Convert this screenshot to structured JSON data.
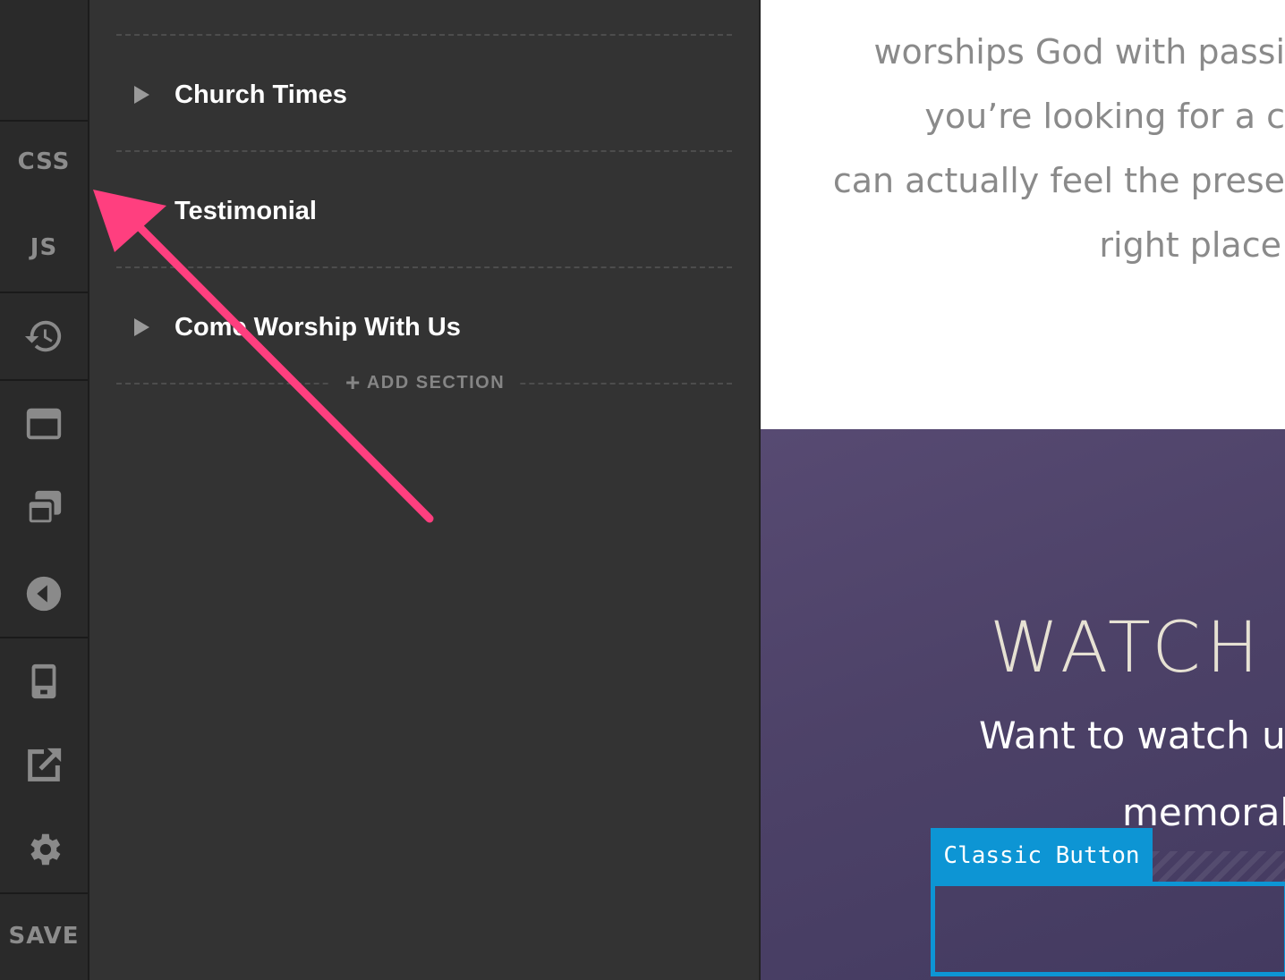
{
  "rail": {
    "css_label": "CSS",
    "js_label": "JS",
    "save_label": "SAVE",
    "icons": [
      "history-icon",
      "layout-icon",
      "layers-icon",
      "back-icon",
      "mobile-preview-icon",
      "open-external-icon",
      "gear-icon"
    ]
  },
  "panel": {
    "sections": [
      {
        "label": "Church Times"
      },
      {
        "label": "Testimonial"
      },
      {
        "label": "Come Worship With Us"
      }
    ],
    "add_section_label": "ADD SECTION"
  },
  "preview": {
    "lines": [
      "worships God with passi",
      "you’re looking for a c",
      "can actually feel the prese",
      "right place"
    ],
    "watch_title": "WATCH",
    "watch_sub": "Want to watch us",
    "watch_sub2": "memorab",
    "classic_button_label": "Classic Button"
  },
  "colors": {
    "rail_bg": "#2a2a2a",
    "panel_bg": "#333333",
    "accent_blue": "#0d95d4",
    "annotation_pink": "#ff3f7f",
    "purple_bg": "#4d4268"
  }
}
